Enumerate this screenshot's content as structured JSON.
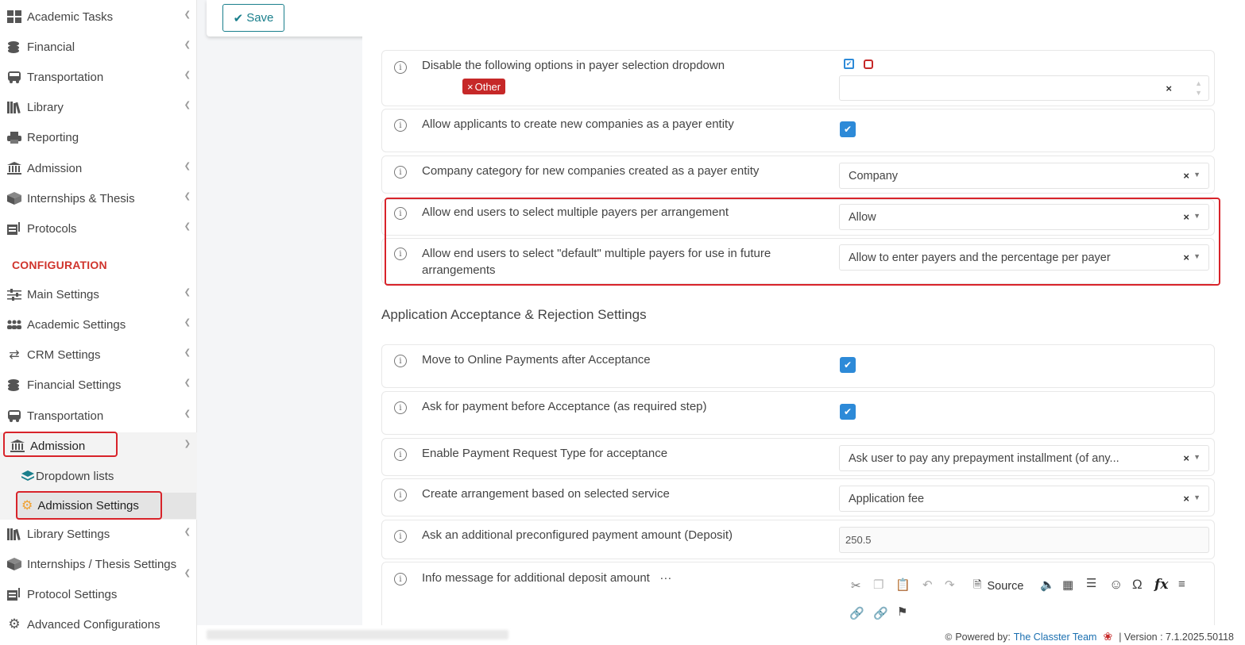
{
  "sidebar": {
    "items": [
      {
        "label": "Academic Tasks",
        "icon": "grid-icon"
      },
      {
        "label": "Financial",
        "icon": "coins-icon"
      },
      {
        "label": "Transportation",
        "icon": "bus-icon"
      },
      {
        "label": "Library",
        "icon": "books-icon"
      },
      {
        "label": "Reporting",
        "icon": "printer-icon"
      },
      {
        "label": "Admission",
        "icon": "bank-icon"
      },
      {
        "label": "Internships & Thesis",
        "icon": "box-icon"
      },
      {
        "label": "Protocols",
        "icon": "register-icon"
      }
    ],
    "section_label": "CONFIGURATION",
    "config_items": [
      {
        "label": "Main Settings",
        "icon": "sliders-icon"
      },
      {
        "label": "Academic Settings",
        "icon": "users-icon"
      },
      {
        "label": "CRM Settings",
        "icon": "shuffle-icon"
      },
      {
        "label": "Financial Settings",
        "icon": "coins-icon"
      },
      {
        "label": "Transportation",
        "icon": "bus-icon"
      },
      {
        "label": "Admission",
        "icon": "bank-icon"
      }
    ],
    "admission_sub": [
      {
        "label": "Dropdown lists",
        "icon": "layers-icon"
      },
      {
        "label": "Admission Settings",
        "icon": "gear-icon"
      }
    ],
    "config_items_after": [
      {
        "label": "Library Settings",
        "icon": "books-icon"
      },
      {
        "label": "Internships / Thesis Settings",
        "icon": "box-icon"
      },
      {
        "label": "Protocol Settings",
        "icon": "register-icon"
      },
      {
        "label": "Advanced Configurations",
        "icon": "gears-icon"
      }
    ]
  },
  "toolbar": {
    "save_label": "Save"
  },
  "settings": {
    "disable_options": {
      "label": "Disable the following options in payer selection dropdown",
      "tag": "Other"
    },
    "allow_new_companies": {
      "label": "Allow applicants to create new companies as a payer entity",
      "checked": true
    },
    "company_category": {
      "label": "Company category for new companies created as a payer entity",
      "value": "Company"
    },
    "multiple_payers": {
      "label": "Allow end users to select multiple payers per arrangement",
      "value": "Allow"
    },
    "default_multiple_payers": {
      "label": "Allow end users to select \"default\" multiple payers for use in future arrangements",
      "value": "Allow to enter payers and the percentage per payer"
    }
  },
  "acceptance_section": {
    "title": "Application Acceptance & Rejection Settings",
    "online_payments": {
      "label": "Move to Online Payments after Acceptance",
      "checked": true
    },
    "payment_before": {
      "label": "Ask for payment before Acceptance (as required step)",
      "checked": true
    },
    "payment_request_type": {
      "label": "Enable Payment Request Type for acceptance",
      "value": "Ask user to pay any prepayment installment (of any..."
    },
    "create_arrangement": {
      "label": "Create arrangement based on selected service",
      "value": "Application fee"
    },
    "deposit_amount": {
      "label": "Ask an additional preconfigured payment amount (Deposit)",
      "value": "250.5"
    },
    "info_message": {
      "label": "Info message for additional deposit amount",
      "ellipsis": "···"
    }
  },
  "editor": {
    "source_label": "Source"
  },
  "footer": {
    "powered_prefix": "Powered by:",
    "powered_link": "The Classter Team",
    "version": "| Version : 7.1.2025.50118"
  },
  "colors": {
    "accent": "#1a7f8c",
    "checkbox": "#2d8ad8",
    "highlight": "#d8232a",
    "tag": "#c62828"
  }
}
